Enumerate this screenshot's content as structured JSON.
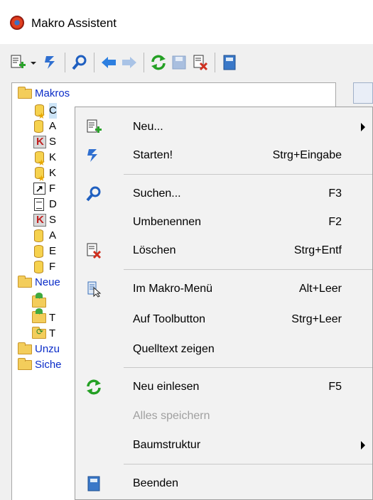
{
  "window": {
    "title": "Makro Assistent"
  },
  "toolbar": {
    "icons": [
      "new-icon",
      "dropdown-icon",
      "run-icon",
      "search-icon",
      "back-icon",
      "forward-icon",
      "refresh-icon",
      "save-icon",
      "delete-icon",
      "exit-icon"
    ]
  },
  "tree": {
    "items": [
      {
        "label": "Makros",
        "icon": "folder-icon"
      },
      {
        "label": "C",
        "icon": "macro-star-icon"
      },
      {
        "label": "A",
        "icon": "macro-icon"
      },
      {
        "label": "S",
        "icon": "macro-red-icon"
      },
      {
        "label": "K",
        "icon": "macro-star-icon"
      },
      {
        "label": "K",
        "icon": "macro-star-icon"
      },
      {
        "label": "F",
        "icon": "shortcut-icon"
      },
      {
        "label": "D",
        "icon": "document-icon"
      },
      {
        "label": "S",
        "icon": "macro-red-icon"
      },
      {
        "label": "A",
        "icon": "macro-icon"
      },
      {
        "label": "E",
        "icon": "macro-icon"
      },
      {
        "label": "F",
        "icon": "macro-icon"
      },
      {
        "label": "Neue",
        "icon": "folder-icon"
      },
      {
        "label": "",
        "icon": "folder-green-icon"
      },
      {
        "label": "T",
        "icon": "folder-green-icon"
      },
      {
        "label": "T",
        "icon": "folder-refresh-icon"
      },
      {
        "label": "Unzu",
        "icon": "folder-icon"
      },
      {
        "label": "Siche",
        "icon": "folder-icon"
      }
    ]
  },
  "context_menu": {
    "items": [
      {
        "label": "Neu...",
        "shortcut": "",
        "icon": "new-icon",
        "submenu": true
      },
      {
        "label": "Starten!",
        "shortcut": "Strg+Eingabe",
        "icon": "run-icon"
      },
      {
        "label": "Suchen...",
        "shortcut": "F3",
        "icon": "search-icon"
      },
      {
        "label": "Umbenennen",
        "shortcut": "F2",
        "icon": ""
      },
      {
        "label": "Löschen",
        "shortcut": "Strg+Entf",
        "icon": "delete-icon"
      },
      {
        "label": "Im Makro-Menü",
        "shortcut": "Alt+Leer",
        "icon": "menu-icon"
      },
      {
        "label": "Auf Toolbutton",
        "shortcut": "Strg+Leer",
        "icon": ""
      },
      {
        "label": "Quelltext zeigen",
        "shortcut": "",
        "icon": ""
      },
      {
        "label": "Neu einlesen",
        "shortcut": "F5",
        "icon": "refresh-icon"
      },
      {
        "label": "Alles speichern",
        "shortcut": "",
        "icon": "",
        "disabled": true
      },
      {
        "label": "Baumstruktur",
        "shortcut": "",
        "icon": "",
        "submenu": true
      },
      {
        "label": "Beenden",
        "shortcut": "",
        "icon": "exit-icon"
      }
    ]
  },
  "colors": {
    "selection": "#cce4f7",
    "folder_label": "#0a2cc8",
    "disabled_text": "#a0a0a0",
    "menu_bg": "#f2f2f2"
  }
}
